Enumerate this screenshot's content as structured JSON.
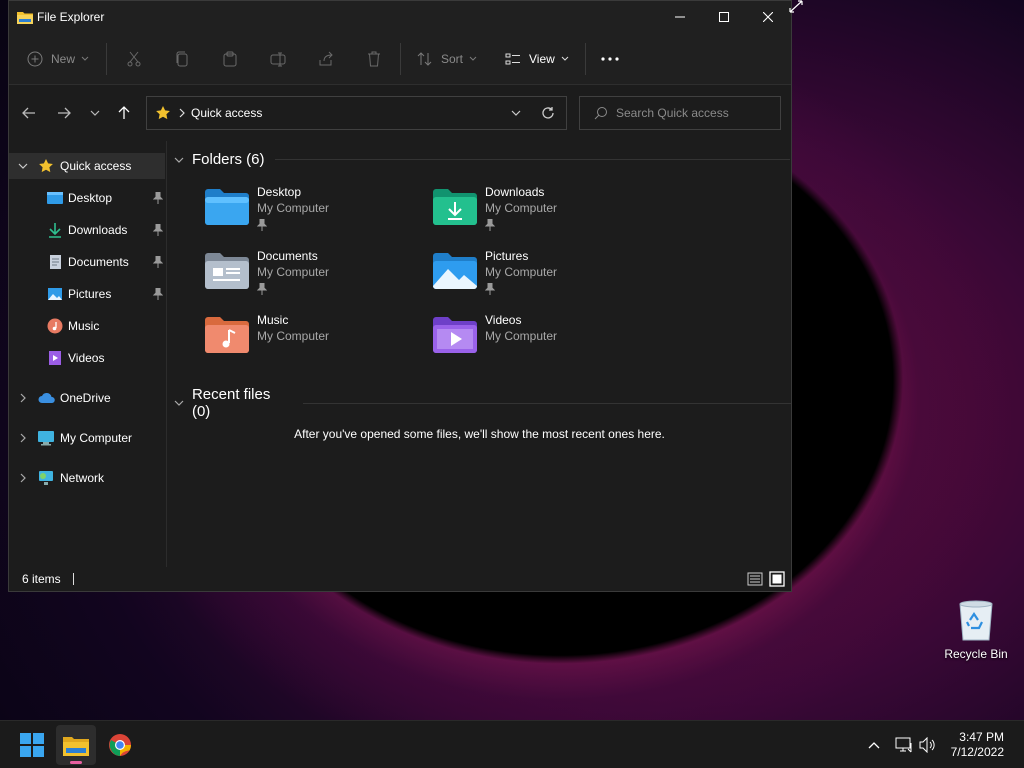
{
  "window": {
    "title": "File Explorer"
  },
  "toolbar": {
    "new_label": "New",
    "sort_label": "Sort",
    "view_label": "View"
  },
  "address": {
    "crumb": "Quick access"
  },
  "search": {
    "placeholder": "Search Quick access"
  },
  "sidebar": {
    "quick_access": "Quick access",
    "items": [
      {
        "label": "Desktop",
        "icon": "desktop-icon"
      },
      {
        "label": "Downloads",
        "icon": "download-icon"
      },
      {
        "label": "Documents",
        "icon": "document-icon"
      },
      {
        "label": "Pictures",
        "icon": "pictures-icon"
      },
      {
        "label": "Music",
        "icon": "music-icon"
      },
      {
        "label": "Videos",
        "icon": "videos-icon"
      }
    ],
    "onedrive": "OneDrive",
    "my_computer": "My Computer",
    "network": "Network"
  },
  "main": {
    "folders_header": "Folders (6)",
    "folders": [
      {
        "name": "Desktop",
        "location": "My Computer"
      },
      {
        "name": "Downloads",
        "location": "My Computer"
      },
      {
        "name": "Documents",
        "location": "My Computer"
      },
      {
        "name": "Pictures",
        "location": "My Computer"
      },
      {
        "name": "Music",
        "location": "My Computer"
      },
      {
        "name": "Videos",
        "location": "My Computer"
      }
    ],
    "recent_header": "Recent files (0)",
    "recent_empty": "After you've opened some files, we'll show the most recent ones here."
  },
  "status": {
    "count": "6 items"
  },
  "desktop": {
    "recycle_bin": "Recycle Bin"
  },
  "clock": {
    "time": "3:47 PM",
    "date": "7/12/2022"
  },
  "colors": {
    "accent": "#0078d4",
    "window_bg": "#1c1c1c",
    "folder_yellow": "#f2c12e"
  }
}
